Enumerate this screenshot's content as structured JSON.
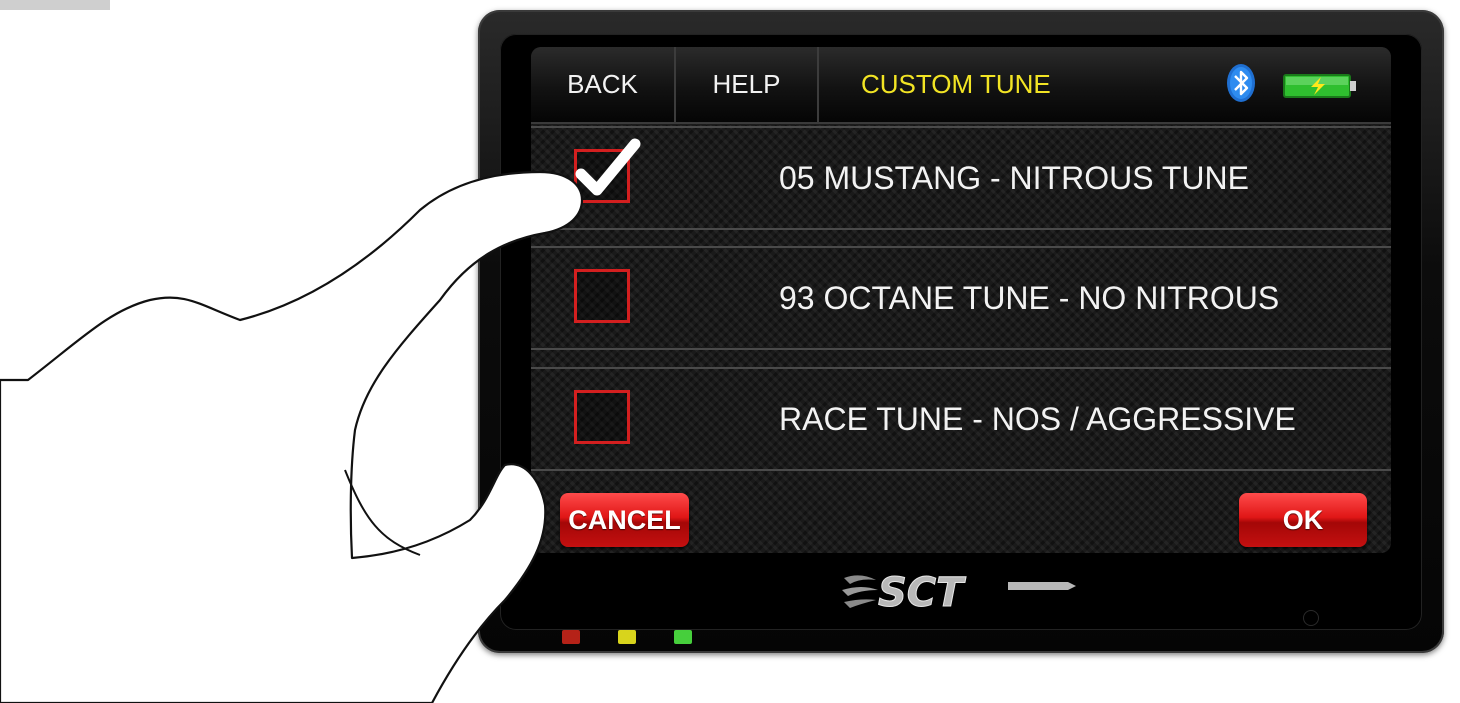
{
  "topbar": {
    "back_label": "BACK",
    "help_label": "HELP",
    "title": "CUSTOM TUNE",
    "title_color": "#f2e424",
    "bluetooth_icon": "bluetooth-icon",
    "battery_icon": "battery-charging-icon"
  },
  "tunes": [
    {
      "label": "05 MUSTANG - NITROUS TUNE",
      "checked": true
    },
    {
      "label": "93 OCTANE TUNE - NO NITROUS",
      "checked": false
    },
    {
      "label": "RACE TUNE - NOS / AGGRESSIVE",
      "checked": false
    }
  ],
  "actions": {
    "cancel_label": "CANCEL",
    "ok_label": "OK",
    "button_color": "#e01616"
  },
  "device": {
    "logo_text": "SCT",
    "leds": [
      "red",
      "yellow",
      "green"
    ]
  }
}
